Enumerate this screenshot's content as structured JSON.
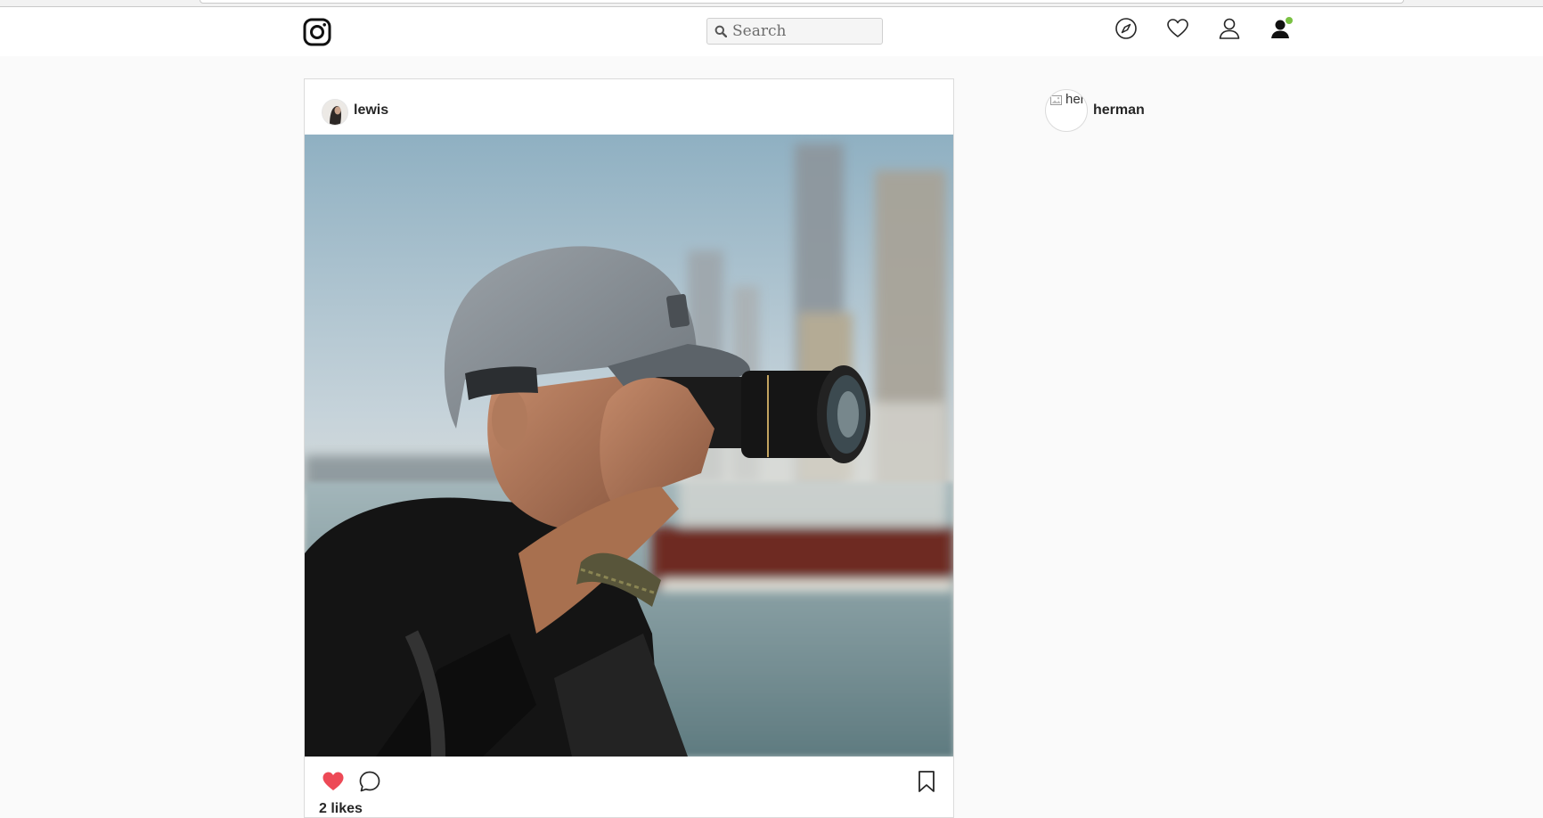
{
  "navbar": {
    "search_placeholder": "Search",
    "icons": [
      "instagram-logo",
      "compass-icon",
      "heart-icon",
      "profile-icon",
      "user-notification-icon"
    ],
    "notification_dot_color": "#7ac142"
  },
  "post": {
    "username": "lewis",
    "image_alt": "Man in grey cap taking a photo with a camera by the waterfront",
    "liked": true,
    "like_color": "#ed4956",
    "likes_text": "2 likes"
  },
  "sidebar": {
    "suggestion_alt": "her",
    "suggestion_name": "herman"
  }
}
